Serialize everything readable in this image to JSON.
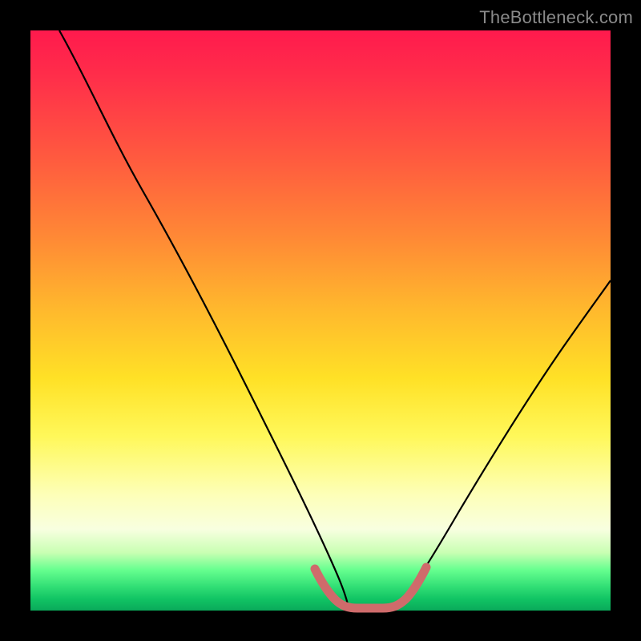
{
  "watermark": "TheBottleneck.com",
  "chart_data": {
    "type": "line",
    "title": "",
    "xlabel": "",
    "ylabel": "",
    "xlim": [
      0,
      100
    ],
    "ylim": [
      0,
      100
    ],
    "grid": false,
    "legend": false,
    "series": [
      {
        "name": "left-curve",
        "color": "#000000",
        "x": [
          5,
          10,
          15,
          20,
          25,
          30,
          35,
          40,
          45,
          49,
          52,
          54
        ],
        "y": [
          100,
          92,
          83,
          73,
          63,
          52,
          41,
          30,
          18,
          8,
          3,
          1
        ]
      },
      {
        "name": "right-curve",
        "color": "#000000",
        "x": [
          63,
          66,
          70,
          74,
          78,
          82,
          86,
          90,
          94,
          98,
          100
        ],
        "y": [
          1,
          3,
          8,
          14,
          21,
          28,
          35,
          42,
          49,
          56,
          60
        ]
      },
      {
        "name": "bottom-band-left",
        "color": "#d46a6a",
        "x": [
          49,
          50.5,
          52,
          53.5,
          54.5,
          56,
          57.5,
          59,
          60.5
        ],
        "y": [
          7,
          5,
          3.2,
          2,
          1.2,
          0.8,
          0.6,
          0.6,
          0.6
        ]
      },
      {
        "name": "bottom-band-right",
        "color": "#d46a6a",
        "x": [
          60.5,
          62,
          63.5,
          65,
          66.5,
          68
        ],
        "y": [
          0.6,
          0.8,
          1.5,
          3,
          5,
          7.5
        ]
      }
    ],
    "annotations": []
  }
}
